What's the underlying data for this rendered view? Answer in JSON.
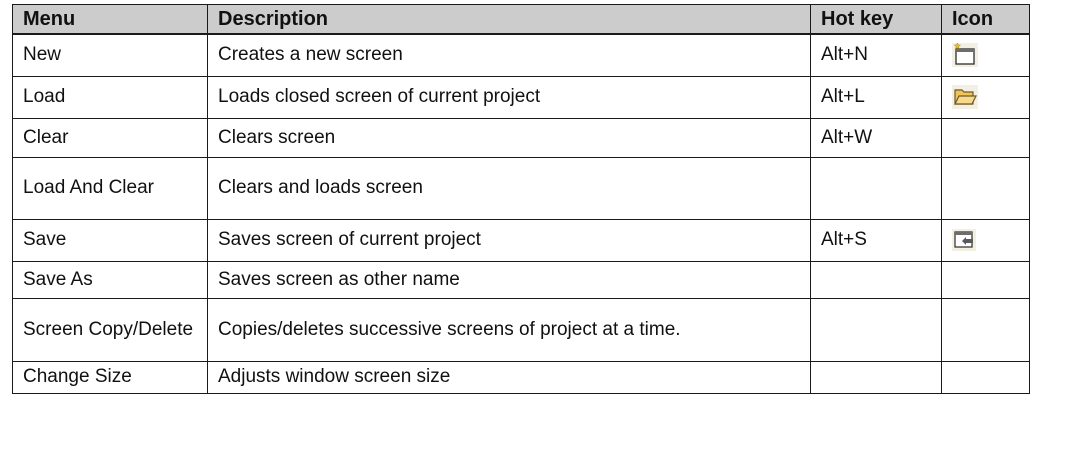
{
  "table": {
    "headers": {
      "menu": "Menu",
      "description": "Description",
      "hotkey": "Hot key",
      "icon": "Icon"
    },
    "rows": [
      {
        "menu": "New",
        "description": "Creates a new screen",
        "hotkey": "Alt+N",
        "icon": "new-screen-icon"
      },
      {
        "menu": "Load",
        "description": "Loads closed screen of current project",
        "hotkey": "Alt+L",
        "icon": "open-folder-icon"
      },
      {
        "menu": "Clear",
        "description": "Clears screen",
        "hotkey": "Alt+W",
        "icon": ""
      },
      {
        "menu": "Load And Clear",
        "description": "Clears and loads screen",
        "hotkey": "",
        "icon": ""
      },
      {
        "menu": "Save",
        "description": "Saves screen of current project",
        "hotkey": "Alt+S",
        "icon": "save-screen-icon"
      },
      {
        "menu": "Save As",
        "description": "Saves screen as other name",
        "hotkey": "",
        "icon": ""
      },
      {
        "menu": "Screen Copy/Delete",
        "description": "Copies/deletes successive screens of project at a time.",
        "hotkey": "",
        "icon": ""
      },
      {
        "menu": "Change Size",
        "description": "Adjusts window screen size",
        "hotkey": "",
        "icon": ""
      }
    ]
  }
}
